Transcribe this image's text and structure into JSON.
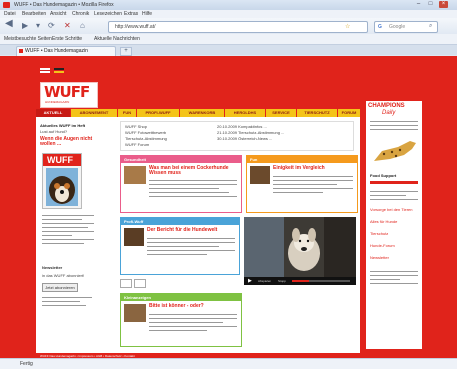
{
  "window": {
    "title": "WUFF • Das Hundemagazin • Mozilla Firefox"
  },
  "menu": [
    "Datei",
    "Bearbeiten",
    "Ansicht",
    "Chronik",
    "Lesezeichen",
    "Extras",
    "Hilfe"
  ],
  "nav": {
    "url": "http://www.wuff.at/",
    "search_placeholder": "Google"
  },
  "bookmarks": [
    "Meistbesuchte Seiten",
    "Erste Schritte",
    "Aktuelle Nachrichten"
  ],
  "tabs": [
    {
      "label": "WUFF • Das Hundemagazin"
    }
  ],
  "page": {
    "logo": "WUFF",
    "logo_sub": "HUNDEMAGAZIN",
    "nav_items": [
      "AKTUELL",
      "ABONNEMENT",
      "FUN",
      "PROFI-WUFF",
      "WARENKORB",
      "HEROLDHS",
      "SERVICE",
      "TIERSCHUTZ",
      "FORUM"
    ],
    "intro": {
      "title": "Aktuelles WUFF im Heft",
      "subtitle": "Lust auf Hund?"
    },
    "promo_headline": "Wenn die Augen nicht wollen ...",
    "issue_title": "WUFF",
    "sidebar_heading": "Newsletter",
    "sidebar_text": "in das WUFF abonniert!",
    "sidebar_button": "Jetzt abonnieren",
    "news_links": [
      "WUFF Shop",
      "WUFF Fotowettbewerb",
      "Tierschutz-Abstimmung",
      "WUFF Forum"
    ],
    "news_dates": [
      "20.10.2009 Kompaktinfos ...",
      "21.10.2009 Tierschutz-Abstimmung ...",
      "30.10.2009 Österreich-News ..."
    ],
    "box1": {
      "title": "Gesundheit",
      "headline": "Was man bei einem Cockerhunde Wissen muss"
    },
    "box2": {
      "title": "Fun",
      "headline": "Einigkeit im Vergleich"
    },
    "box3": {
      "title": "Profi-Wuff",
      "headline": "Der Bericht für die Hundewelt"
    },
    "box4": {
      "title": "Kleinanzeigen",
      "headline": "Bitte ist könner - oder?"
    },
    "video_controls": [
      "Abspielen",
      "Stopp"
    ],
    "champions": {
      "title": "CHAMPIONS",
      "subtitle": "Daily",
      "product_label": "Food Support",
      "links": [
        "Vorsorge bei den Tieren",
        "Alles für Hunde",
        "Tierschutz",
        "Hunde-Forum",
        "Newsletter"
      ]
    },
    "footer_text": "WUFF Das Hundemagazin • Impressum • AGB • Datenschutz • Kontakt"
  },
  "status": {
    "text": "Fertig"
  },
  "colors": {
    "brand_red": "#e0231b",
    "nav_yellow": "#f4c419",
    "box_pink": "#ea5d8a",
    "box_orange": "#f59a1d",
    "box_blue": "#4aa3d8",
    "box_green": "#7fc242"
  }
}
